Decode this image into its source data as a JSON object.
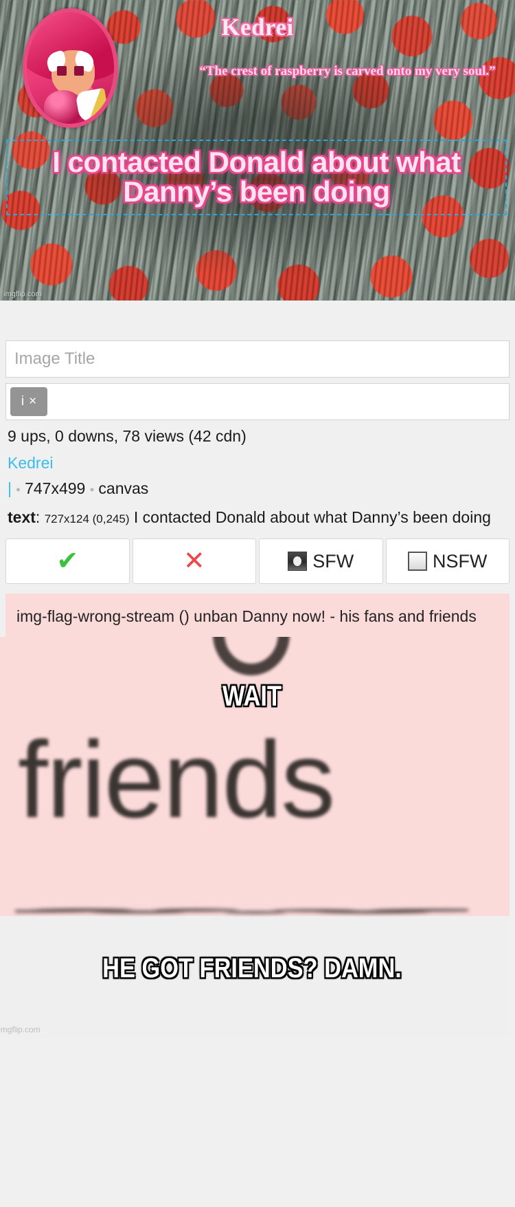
{
  "top_meme": {
    "username": "Kedrei",
    "quote": "“The crest of raspberry is carved onto my very soul.”",
    "caption": "I contacted Donald about what Danny’s been doing",
    "watermark": "imgflip.com",
    "avatar_icon": "cookie-character-avatar",
    "selection_icon": "selection-box-icon"
  },
  "form": {
    "title_input": {
      "value": "",
      "placeholder": "Image Title"
    },
    "tags_input": {
      "value": "",
      "placeholder": ""
    },
    "tag_chip": {
      "label": "i",
      "remove": "×"
    },
    "stats": "9 ups, 0 downs, 78 views (42 cdn)",
    "author": "Kedrei",
    "dims": {
      "pipe": "|",
      "dot": "•",
      "size": "747x499",
      "kind": "canvas"
    },
    "text_meta": {
      "label": "text",
      "colon": ":",
      "coords": "727x124 (0,245)",
      "content": "I contacted Donald about what Danny’s been doing"
    }
  },
  "buttons": {
    "approve": {
      "glyph": "✔",
      "name": "check-icon"
    },
    "reject": {
      "glyph": "✕",
      "name": "cross-icon"
    },
    "sfw": {
      "label": "SFW",
      "selected": true
    },
    "nsfw": {
      "label": "NSFW",
      "selected": false
    }
  },
  "flag": {
    "note": "img-flag-wrong-stream () unban Danny now! - his fans and friends"
  },
  "bottom_meme": {
    "background_word": "friends",
    "top_text": "WAIT",
    "bottom_text": "HE GOT FRIENDS? DAMN.",
    "watermark": "imgflip.com"
  },
  "colors": {
    "accent_link": "#3bbced",
    "selection": "#29a8e0",
    "flag_bg": "#fbdada",
    "page_bg": "#f0f0f0",
    "check_green": "#3cc241",
    "cross_red": "#f0464b"
  }
}
